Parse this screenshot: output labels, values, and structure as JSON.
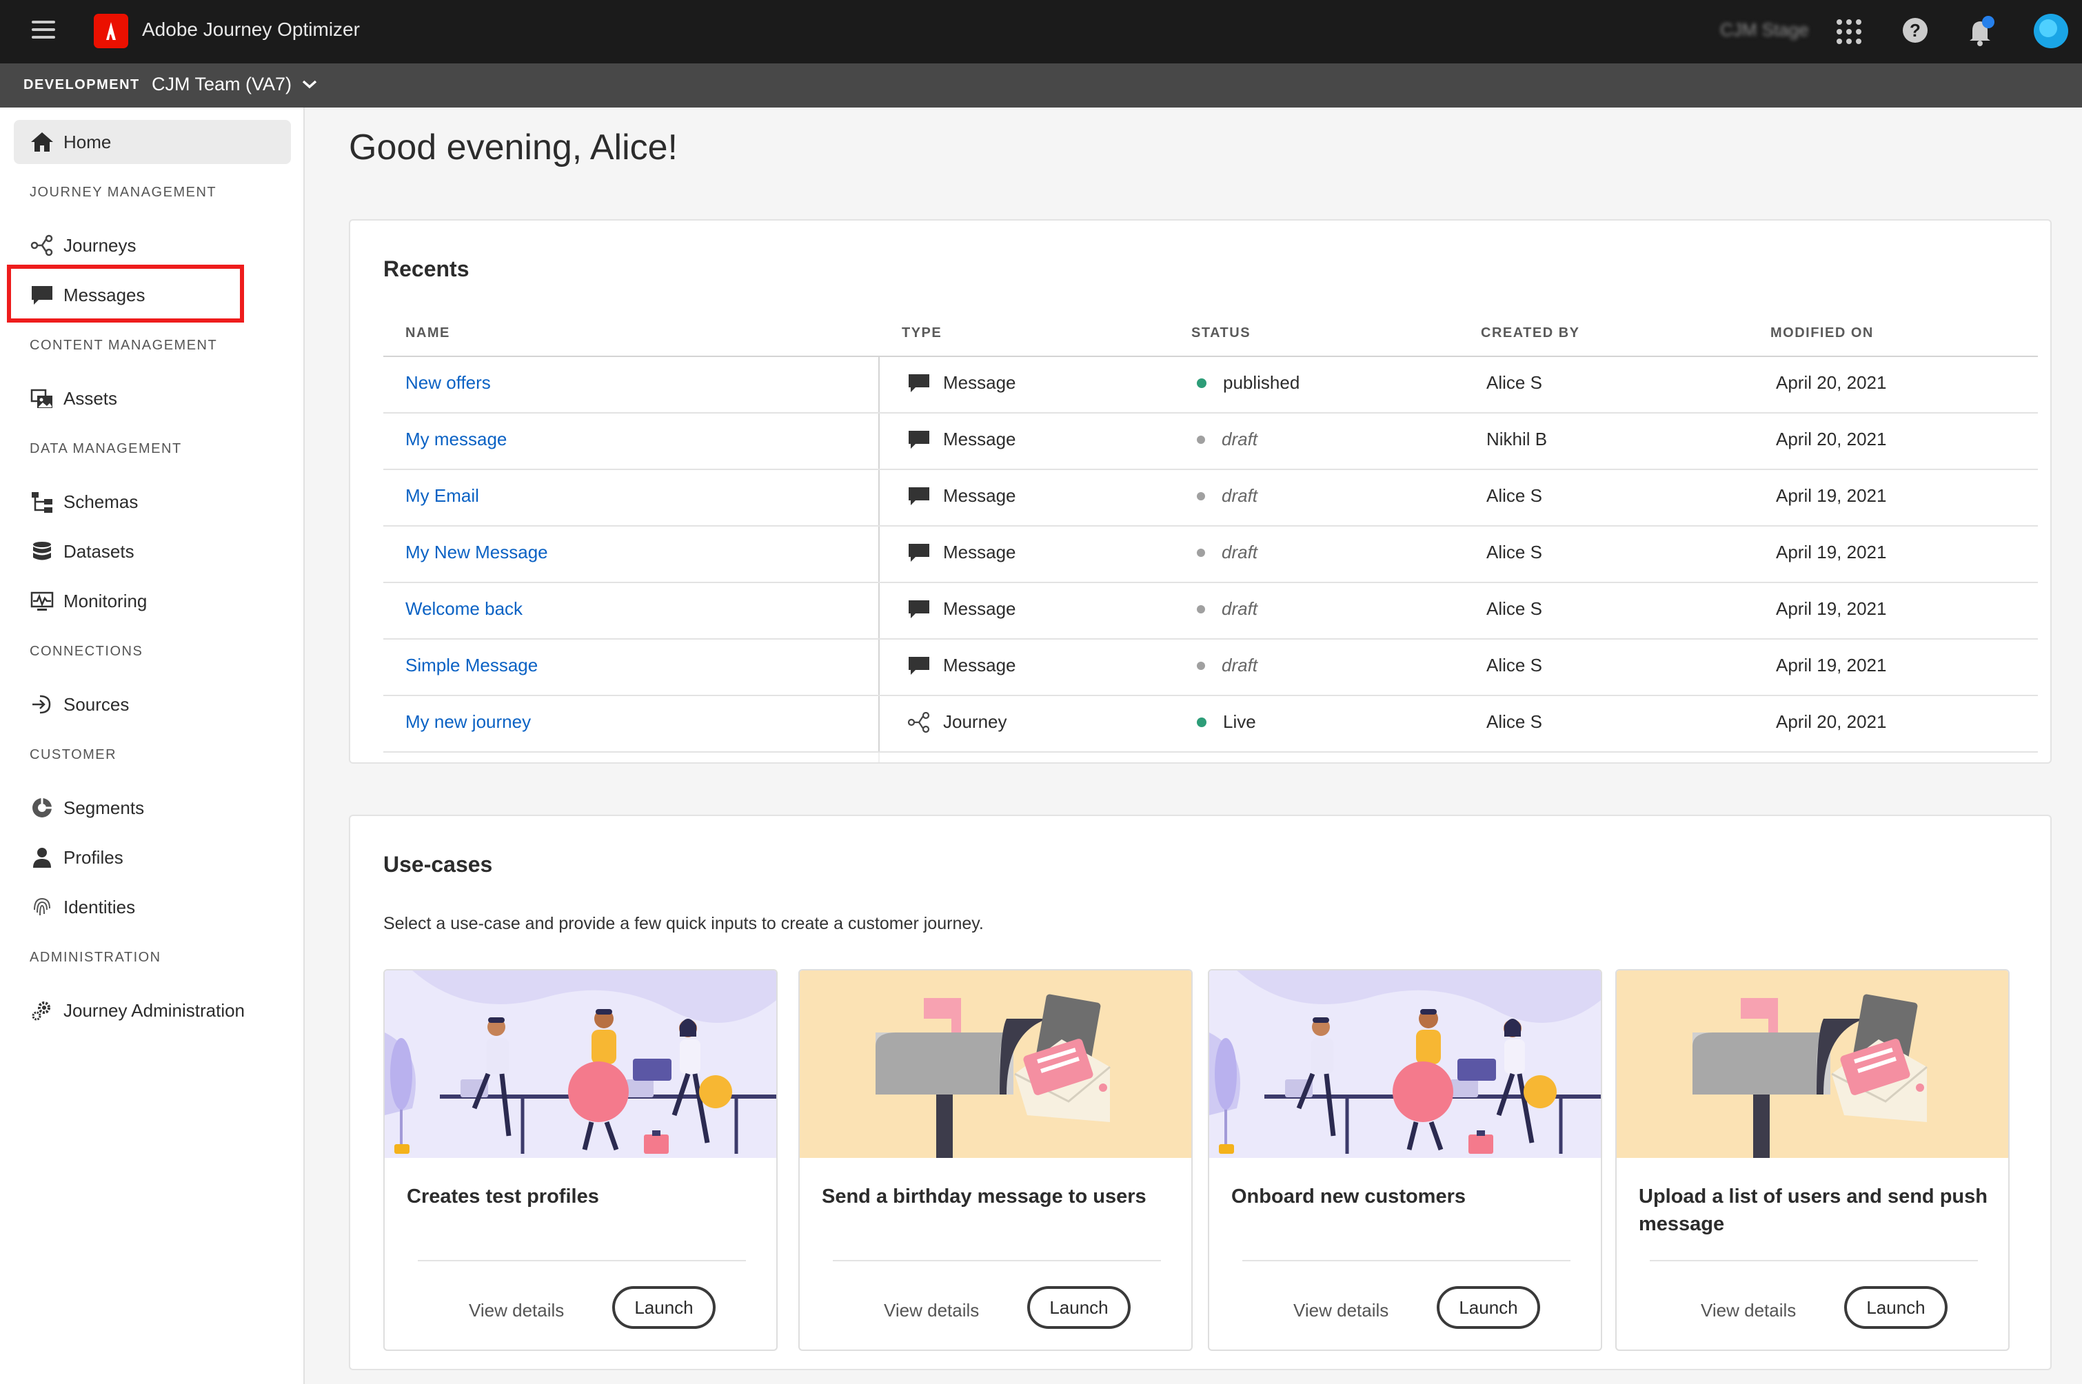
{
  "topbar": {
    "app_title": "Adobe Journey Optimizer",
    "org_name": "CJM Stage"
  },
  "subbar": {
    "environment": "DEVELOPMENT",
    "team": "CJM Team (VA7)"
  },
  "sidebar": {
    "home": "Home",
    "sections": {
      "journey_management": "JOURNEY MANAGEMENT",
      "content_management": "CONTENT MANAGEMENT",
      "data_management": "DATA MANAGEMENT",
      "connections": "CONNECTIONS",
      "customer": "CUSTOMER",
      "administration": "ADMINISTRATION"
    },
    "items": {
      "journeys": "Journeys",
      "messages": "Messages",
      "assets": "Assets",
      "schemas": "Schemas",
      "datasets": "Datasets",
      "monitoring": "Monitoring",
      "sources": "Sources",
      "segments": "Segments",
      "profiles": "Profiles",
      "identities": "Identities",
      "journey_administration": "Journey Administration"
    }
  },
  "main": {
    "greeting": "Good evening, Alice!",
    "recents": {
      "title": "Recents",
      "columns": [
        "NAME",
        "TYPE",
        "STATUS",
        "CREATED BY",
        "MODIFIED ON"
      ],
      "rows": [
        {
          "name": "New offers",
          "type": "Message",
          "status": "published",
          "created_by": "Alice S",
          "modified_on": "April 20, 2021"
        },
        {
          "name": "My message",
          "type": "Message",
          "status": "draft",
          "created_by": "Nikhil B",
          "modified_on": "April 20, 2021"
        },
        {
          "name": "My Email",
          "type": "Message",
          "status": "draft",
          "created_by": "Alice S",
          "modified_on": "April 19, 2021"
        },
        {
          "name": "My New Message",
          "type": "Message",
          "status": "draft",
          "created_by": "Alice S",
          "modified_on": "April 19, 2021"
        },
        {
          "name": "Welcome back",
          "type": "Message",
          "status": "draft",
          "created_by": "Alice S",
          "modified_on": "April 19, 2021"
        },
        {
          "name": "Simple Message",
          "type": "Message",
          "status": "draft",
          "created_by": "Alice S",
          "modified_on": "April 19, 2021"
        },
        {
          "name": "My new journey",
          "type": "Journey",
          "status": "Live",
          "created_by": "Alice S",
          "modified_on": "April 20, 2021"
        }
      ]
    },
    "usecases": {
      "title": "Use-cases",
      "description": "Select a use-case and provide a few quick inputs to create a customer journey.",
      "view_label": "View details",
      "launch_label": "Launch",
      "cards": [
        {
          "title": "Creates test profiles"
        },
        {
          "title": "Send a birthday message to users"
        },
        {
          "title": "Onboard new customers"
        },
        {
          "title": "Upload a list of users and send push message"
        }
      ]
    }
  },
  "colors": {
    "topbar": "#1b1b1b",
    "subbar": "#484848",
    "link": "#0b62c4",
    "status_published": "#2d9d78",
    "status_draft": "#a0a0a0",
    "highlight": "#ee1c1c",
    "adobe_red": "#eb1000"
  }
}
